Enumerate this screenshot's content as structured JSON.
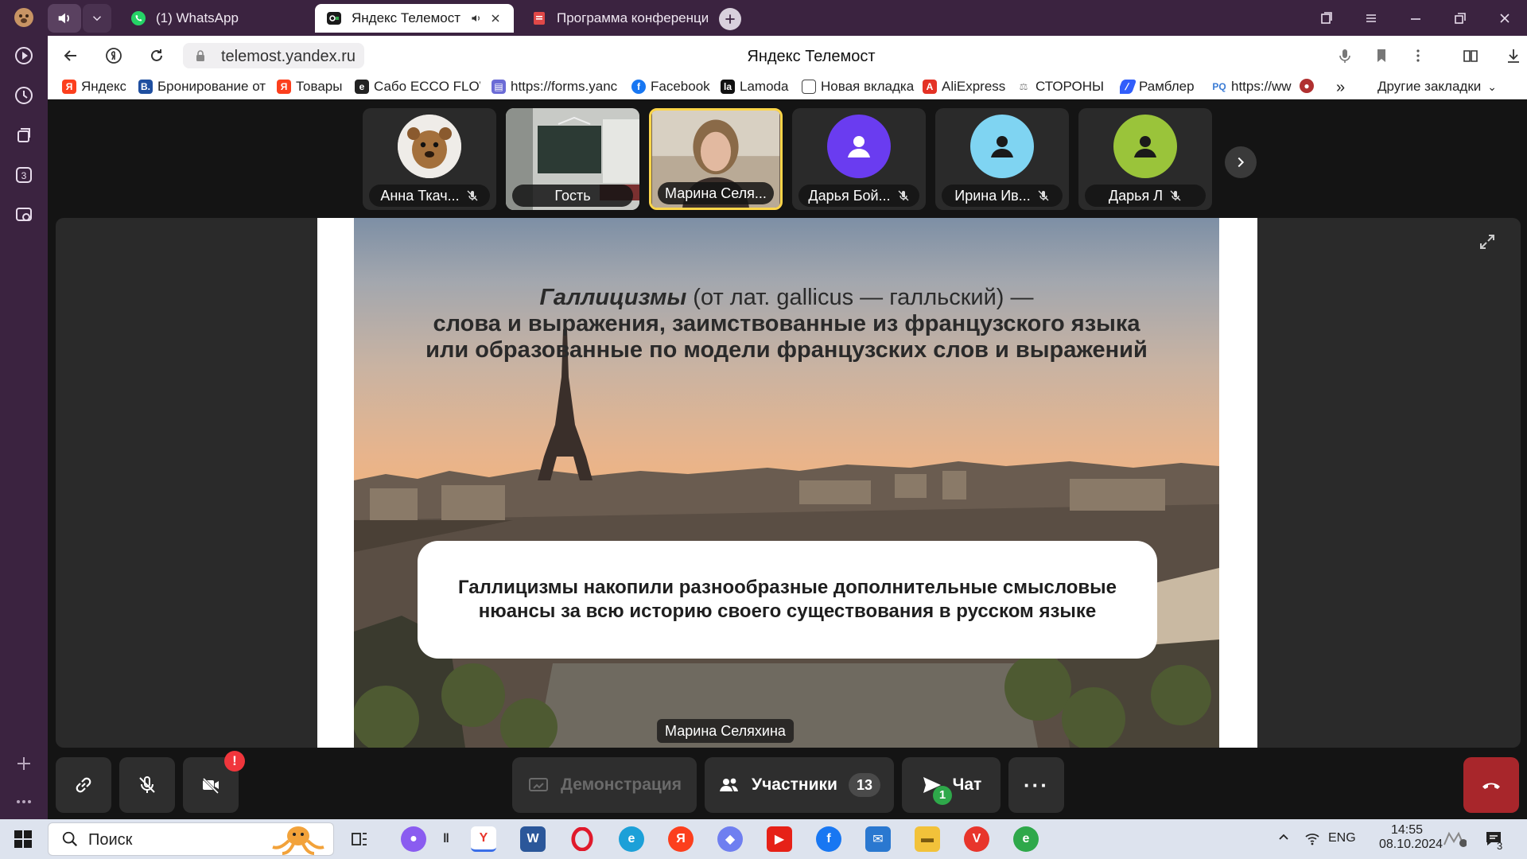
{
  "browser": {
    "tabs": [
      {
        "title": "(1) WhatsApp",
        "active": false
      },
      {
        "title": "Яндекс Телемост",
        "active": true
      },
      {
        "title": "Программа конференции",
        "active": false
      }
    ],
    "url": "telemost.yandex.ru",
    "page_title": "Яндекс Телемост",
    "bookmarks": [
      {
        "label": "Яндекс",
        "icon": "yandex-icon",
        "color": "#fc3f1d"
      },
      {
        "label": "Бронирование от",
        "icon": "booking-icon",
        "color": "#1f4fa0"
      },
      {
        "label": "Товары",
        "icon": "yandex-icon",
        "color": "#fc3f1d"
      },
      {
        "label": "Сабо ECCO FLOW",
        "icon": "ecco-icon",
        "color": "#222222"
      },
      {
        "label": "https://forms.yanc",
        "icon": "forms-icon",
        "color": "#6b6bd6"
      },
      {
        "label": "Facebook",
        "icon": "facebook-icon",
        "color": "#1877f2"
      },
      {
        "label": "Lamoda",
        "icon": "lamoda-icon",
        "color": "#111111"
      },
      {
        "label": "Новая вкладка",
        "icon": "page-icon",
        "color": "#ffffff"
      },
      {
        "label": "AliExpress",
        "icon": "aliexpress-icon",
        "color": "#e43225"
      },
      {
        "label": "СТОРОНЫ",
        "icon": "scales-icon",
        "color": "#888888"
      },
      {
        "label": "Рамблер",
        "icon": "rambler-icon",
        "color": "#315efb"
      },
      {
        "label": "https://ww",
        "icon": "pq-icon",
        "color": "#3a7bd5"
      }
    ],
    "more_bookmarks": "»",
    "other_bookmarks": "Другие закладки"
  },
  "participants": [
    {
      "name": "Анна Ткач...",
      "muted": true,
      "avatar": "photo-bear",
      "color": "#d8cfc6"
    },
    {
      "name": "Гость",
      "muted": false,
      "avatar": "video-classroom",
      "color": "#8a8f8a"
    },
    {
      "name": "Марина Селя...",
      "muted": false,
      "avatar": "video-speaker",
      "color": "#6a5a4a",
      "speaking": true
    },
    {
      "name": "Дарья Бой...",
      "muted": true,
      "avatar": "user-icon",
      "color": "#6a3cf0"
    },
    {
      "name": "Ирина Ив...",
      "muted": true,
      "avatar": "user-icon",
      "color": "#7fd4f2"
    },
    {
      "name": "Дарья Л",
      "muted": true,
      "avatar": "user-icon",
      "color": "#9ac43a"
    }
  ],
  "slide": {
    "title_term": "Галлицизмы",
    "title_rest": " (от лат. gallicus — галльский) —",
    "title_line2": "слова и выражения, заимствованные из французского языка",
    "title_line3": "или образованные по модели французских слов и выражений",
    "callout": "Галлицизмы накопили разнообразные дополнительные смысловые нюансы за всю историю своего существования в русском языке",
    "presenter": "Марина Селяхина"
  },
  "controls": {
    "camera_alert": "!",
    "demo_label": "Демонстрация",
    "participants_label": "Участники",
    "participants_count": "13",
    "chat_label": "Чат",
    "chat_unread": "1",
    "more_label": "···"
  },
  "taskbar": {
    "search_placeholder": "Поиск",
    "lang": "ENG",
    "time": "14:55",
    "date": "08.10.2024",
    "notification_count": "3"
  },
  "colors": {
    "browser_frame": "#3b2340",
    "speaking_border": "#ffd64a",
    "hangup": "#a8262b",
    "alert": "#f0363c",
    "chat_badge": "#2ea84a"
  }
}
